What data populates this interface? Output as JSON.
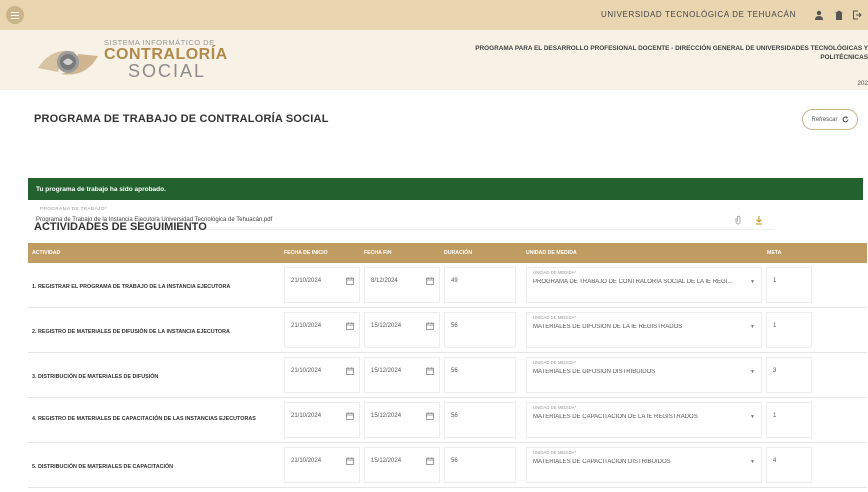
{
  "topbar": {
    "university": "UNIVERSIDAD TECNOLÓGICA DE TEHUACÁN"
  },
  "header": {
    "logo_line1": "SISTEMA INFORMÁTICO DE",
    "logo_line2": "CONTRALORÍA",
    "logo_line3": "SOCIAL",
    "program_name": "PROGRAMA PARA EL DESARROLLO PROFESIONAL DOCENTE - DIRECCIÓN GENERAL DE UNIVERSIDADES TECNOLÓGICAS Y POLITÉCNICAS",
    "year": "202"
  },
  "page": {
    "title": "PROGRAMA DE TRABAJO DE CONTRALORÍA SOCIAL",
    "refresh_label": "Refrescar"
  },
  "banner": {
    "message": "Tu programa de trabajo ha sido aprobado."
  },
  "work_program": {
    "label": "PROGRAMA DE TRABAJO*",
    "value": "Programa de Trabajo de la Instancia Ejecutora Universidad Tecnológica de Tehuacán.pdf"
  },
  "tracking": {
    "title": "ACTIVIDADES DE SEGUIMIENTO",
    "headers": {
      "activity": "ACTIVIDAD",
      "start": "FECHA DE INICIO",
      "end": "FECHA FIN",
      "duration": "DURACIÓN",
      "unit": "UNIDAD DE MEDIDA",
      "goal": "META"
    },
    "unit_label": "UNIDAD DE MEDIDA*",
    "rows": [
      {
        "activity": "1. REGISTRAR EL PROGRAMA DE TRABAJO DE LA INSTANCIA EJECUTORA",
        "start": "21/10/2024",
        "end": "8/12/2024",
        "duration": "49",
        "unit": "PROGRAMA DE TRABAJO DE CONTRALORÍA SOCIAL DE LA IE REGI...",
        "goal": "1"
      },
      {
        "activity": "2. REGISTRO DE MATERIALES DE DIFUSIÓN DE LA INSTANCIA EJECUTORA",
        "start": "21/10/2024",
        "end": "15/12/2024",
        "duration": "56",
        "unit": "MATERIALES DE DIFUSIÓN DE LA IE REGISTRADOS",
        "goal": "1"
      },
      {
        "activity": "3. DISTRIBUCIÓN DE MATERIALES DE DIFUSIÓN",
        "start": "21/10/2024",
        "end": "15/12/2024",
        "duration": "56",
        "unit": "MATERIALES DE DIFUSIÓN DISTRIBUIDOS",
        "goal": "3"
      },
      {
        "activity": "4. REGISTRO DE MATERIALES DE CAPACITACIÓN DE LAS INSTANCIAS EJECUTORAS",
        "start": "21/10/2024",
        "end": "15/12/2024",
        "duration": "56",
        "unit": "MATERIALES DE CAPACITACIÓN DE LA IE REGISTRADOS",
        "goal": "1"
      },
      {
        "activity": "5. DISTRIBUCIÓN DE MATERIALES DE CAPACITACIÓN",
        "start": "21/10/2024",
        "end": "15/12/2024",
        "duration": "56",
        "unit": "MATERIALES DE CAPACITACIÓN DISTRIBUIDOS",
        "goal": "4"
      }
    ]
  },
  "icons": [
    "menu-icon",
    "user-icon",
    "building-icon",
    "logout-icon",
    "refresh-icon",
    "paperclip-icon",
    "download-icon",
    "calendar-icon",
    "chevron-down-icon"
  ],
  "colors": {
    "topbar": "#e9d6b0",
    "header_bg": "#f7f1e6",
    "table_header": "#bf9c62",
    "success": "#23612e",
    "accent": "#b08a4a"
  }
}
